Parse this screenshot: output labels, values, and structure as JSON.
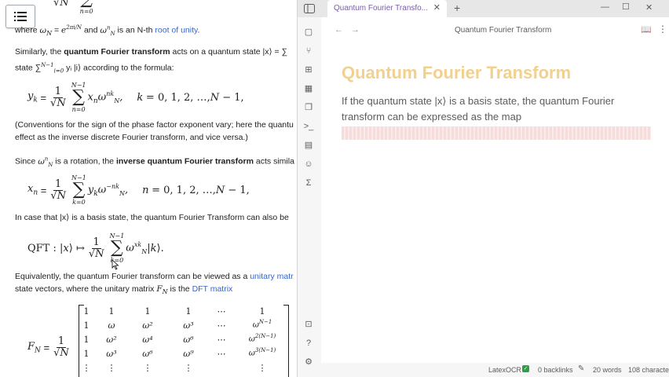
{
  "wiki": {
    "line_where_prefix": "where ",
    "line_where_mid": " and ",
    "line_where_link": "root of unity",
    "line_where_suffix": " is an N-th ",
    "sim_prefix": "Similarly, the ",
    "sim_bold": "quantum Fourier transform",
    "sim_suffix": " acts on a quantum state |x⟩ = ∑",
    "state_prefix": "state ∑",
    "state_suffix": " yᵢ |i⟩ according to the formula:",
    "conv_1": "(Conventions for the sign of the phase factor exponent vary; here the quantu",
    "conv_2": "effect as the inverse discrete Fourier transform, and vice versa.)",
    "since_prefix": "Since ",
    "since_mid": " is a rotation, the ",
    "since_bold": "inverse quantum Fourier transform",
    "since_suffix": " acts simila",
    "incase": "In case that |x⟩ is a basis state, the quantum Fourier Transform can also be",
    "equiv_prefix": "Equivalently, the quantum Fourier transform can be viewed as a ",
    "equiv_link": "unitary matr",
    "sv_prefix": "state vectors, where the unitary matrix ",
    "sv_mid": " is the ",
    "sv_link": "DFT matrix"
  },
  "obsidian": {
    "tab_title": "Quantum Fourier Transfo...",
    "header_title": "Quantum Fourier Transform",
    "note_title": "Quantum Fourier Transform",
    "note_body": "If the quantum state |x⟩ is a basis state, the quantum Fourier transform can be expressed as the map",
    "status": {
      "plugin": "LatexOCR",
      "backlinks": "0 backlinks",
      "words": "20 words",
      "chars": "108 characters"
    },
    "colors": {
      "title": "#f2d08e",
      "accent": "#7b5ea7",
      "highlight": "#f7dcdc"
    }
  }
}
